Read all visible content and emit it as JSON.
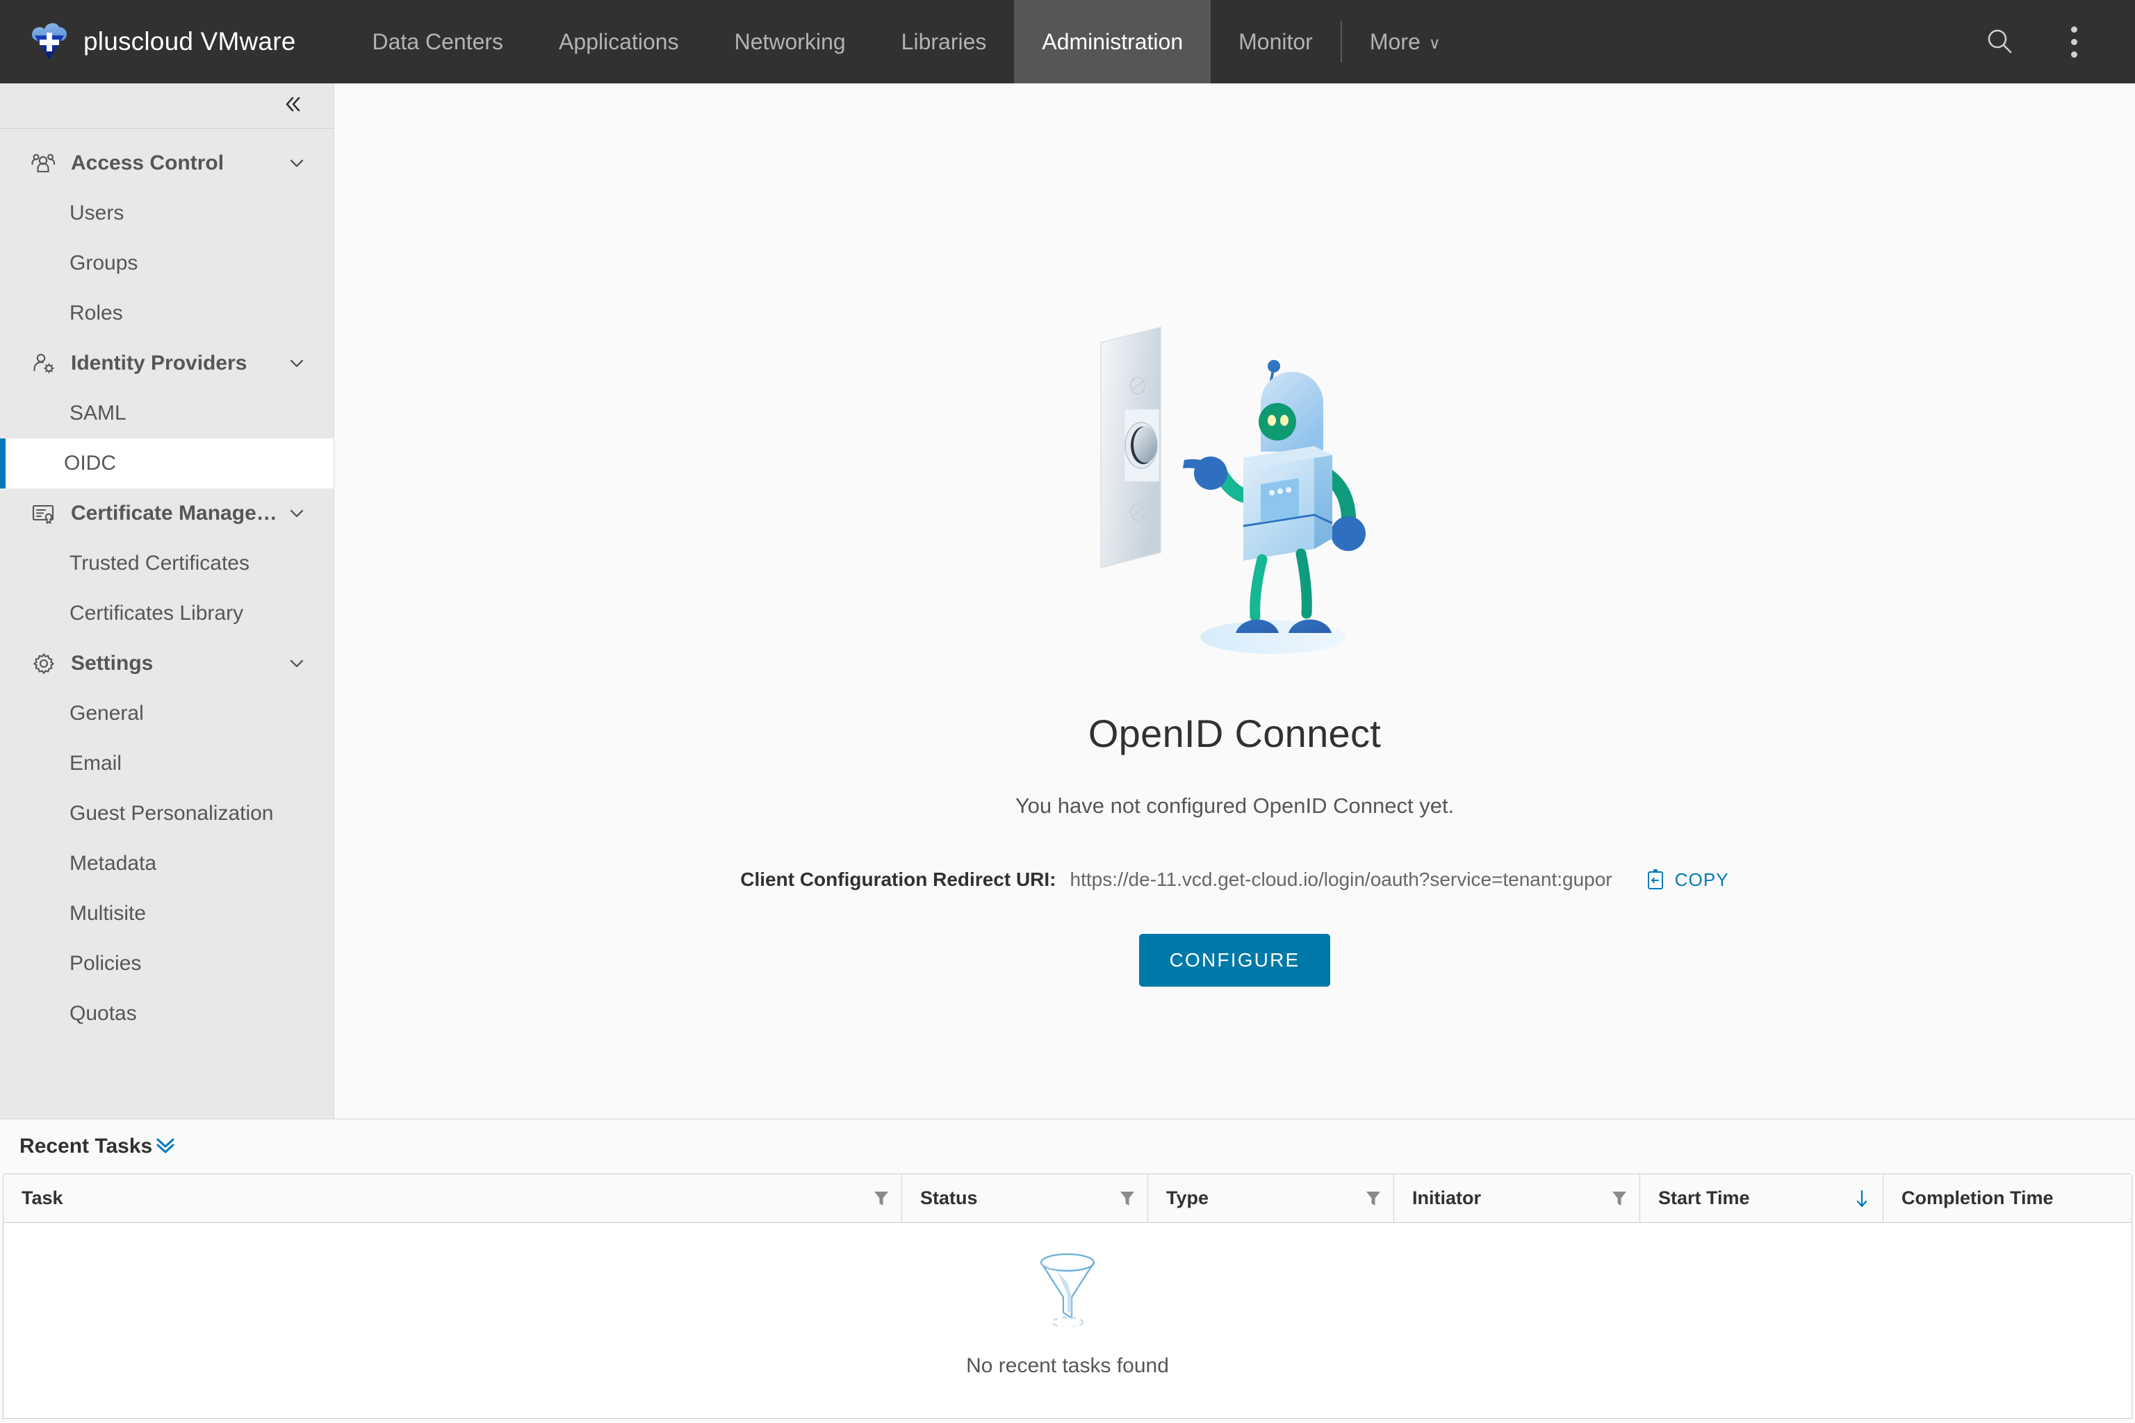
{
  "topnav": {
    "brand": "pluscloud VMware",
    "logo_icon": "cloud-plus-logo",
    "items": [
      {
        "label": "Data Centers",
        "active": false
      },
      {
        "label": "Applications",
        "active": false
      },
      {
        "label": "Networking",
        "active": false
      },
      {
        "label": "Libraries",
        "active": false
      },
      {
        "label": "Administration",
        "active": true
      },
      {
        "label": "Monitor",
        "active": false
      }
    ],
    "more_label": "More",
    "more_caret": "∨",
    "search_icon": "search-icon",
    "overflow_icon": "kebab-menu-icon",
    "active_bg": "#565656",
    "bg": "#313131"
  },
  "sidebar": {
    "collapse_icon": "double-chevron-left-icon",
    "groups": [
      {
        "label": "Access Control",
        "icon": "users-group-icon",
        "expanded": true,
        "items": [
          {
            "label": "Users",
            "selected": false
          },
          {
            "label": "Groups",
            "selected": false
          },
          {
            "label": "Roles",
            "selected": false
          }
        ]
      },
      {
        "label": "Identity Providers",
        "icon": "user-gear-icon",
        "expanded": true,
        "items": [
          {
            "label": "SAML",
            "selected": false
          },
          {
            "label": "OIDC",
            "selected": true
          }
        ]
      },
      {
        "label": "Certificate Managem...",
        "icon": "certificate-icon",
        "expanded": true,
        "items": [
          {
            "label": "Trusted Certificates",
            "selected": false
          },
          {
            "label": "Certificates Library",
            "selected": false
          }
        ]
      },
      {
        "label": "Settings",
        "icon": "gear-icon",
        "expanded": true,
        "items": [
          {
            "label": "General",
            "selected": false
          },
          {
            "label": "Email",
            "selected": false
          },
          {
            "label": "Guest Personalization",
            "selected": false
          },
          {
            "label": "Metadata",
            "selected": false
          },
          {
            "label": "Multisite",
            "selected": false
          },
          {
            "label": "Policies",
            "selected": false
          },
          {
            "label": "Quotas",
            "selected": false
          }
        ]
      }
    ],
    "selected_accent": "#0079b8"
  },
  "main": {
    "illustration": "robot-pressing-button-illustration",
    "title": "OpenID Connect",
    "subtitle": "You have not configured OpenID Connect yet.",
    "uri_label": "Client Configuration Redirect URI:",
    "uri_value": "https://de-11.vcd.get-cloud.io/login/oauth?service=tenant:gupor",
    "copy_label": "COPY",
    "copy_icon": "clipboard-copy-icon",
    "configure_label": "CONFIGURE",
    "configure_color": "#0079a8"
  },
  "tasks": {
    "title": "Recent Tasks",
    "collapse_icon": "double-chevron-down-icon",
    "columns": [
      {
        "label": "Task",
        "filter": true,
        "sort": false
      },
      {
        "label": "Status",
        "filter": true,
        "sort": false
      },
      {
        "label": "Type",
        "filter": true,
        "sort": false
      },
      {
        "label": "Initiator",
        "filter": true,
        "sort": false
      },
      {
        "label": "Start Time",
        "filter": false,
        "sort": true
      },
      {
        "label": "Completion Time",
        "filter": false,
        "sort": false
      }
    ],
    "empty_icon": "funnel-icon",
    "empty_text": "No recent tasks found",
    "rows": []
  }
}
